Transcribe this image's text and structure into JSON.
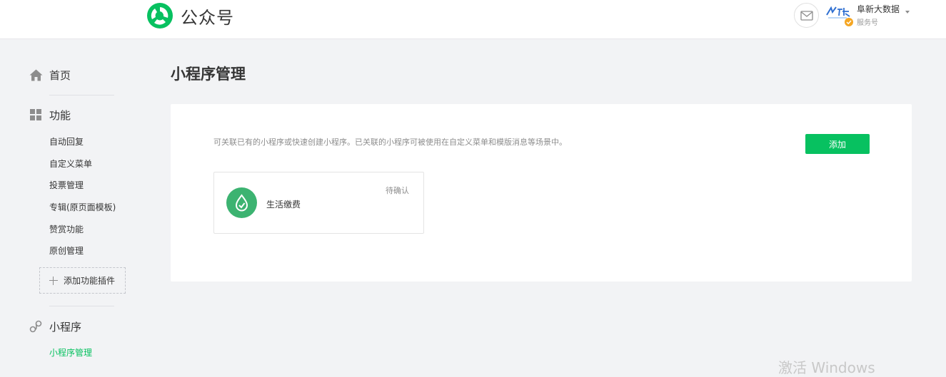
{
  "header": {
    "product_name": "公众号",
    "account": {
      "name": "阜新大数据",
      "type": "服务号"
    },
    "icons": {
      "logo": "wechat-logo-icon",
      "mail": "mail-icon",
      "caret": "caret-down-icon"
    }
  },
  "sidebar": {
    "home": {
      "label": "首页",
      "icon": "home-icon"
    },
    "features": {
      "label": "功能",
      "icon": "grid-icon",
      "items": [
        {
          "label": "自动回复"
        },
        {
          "label": "自定义菜单"
        },
        {
          "label": "投票管理"
        },
        {
          "label": "专辑(原页面模板)"
        },
        {
          "label": "赞赏功能"
        },
        {
          "label": "原创管理"
        }
      ],
      "add_plugin_label": "添加功能插件"
    },
    "mini_program": {
      "label": "小程序",
      "icon": "link-icon",
      "items": [
        {
          "label": "小程序管理",
          "active": true
        }
      ]
    }
  },
  "main": {
    "title": "小程序管理",
    "description": "可关联已有的小程序或快速创建小程序。已关联的小程序可被使用在自定义菜单和模版消息等场景中。",
    "add_button_label": "添加",
    "mini_programs": [
      {
        "name": "生活缴费",
        "status": "待确认",
        "icon": "mini-program-icon"
      }
    ]
  },
  "watermark": "激活 Windows",
  "colors": {
    "accent": "#07c160",
    "background": "#f2f3f5",
    "text": "#353535",
    "muted": "#8d8d8d"
  }
}
